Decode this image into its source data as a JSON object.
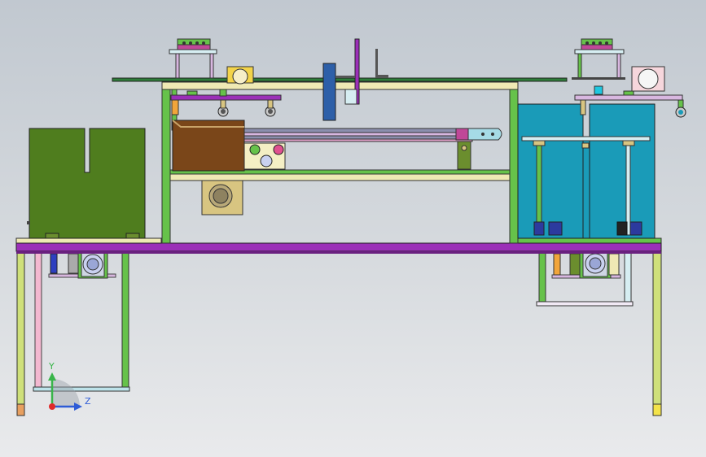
{
  "triad": {
    "y_label": "Y",
    "z_label": "Z"
  },
  "colors": {
    "bg_top": "#c1c8d0",
    "bg_bottom": "#e9eaec",
    "frame_purple": "#9b2fb8",
    "rail_green": "#66c24a",
    "olive_block": "#4f7d1e",
    "teal_box": "#1a9bb8",
    "brown_box": "#7a4619",
    "plate": "#efe9b4",
    "motor_tan": "#d8c581",
    "axis_y": "#39b54a",
    "axis_z": "#2e5bd6",
    "axis_origin": "#e02a2a"
  }
}
